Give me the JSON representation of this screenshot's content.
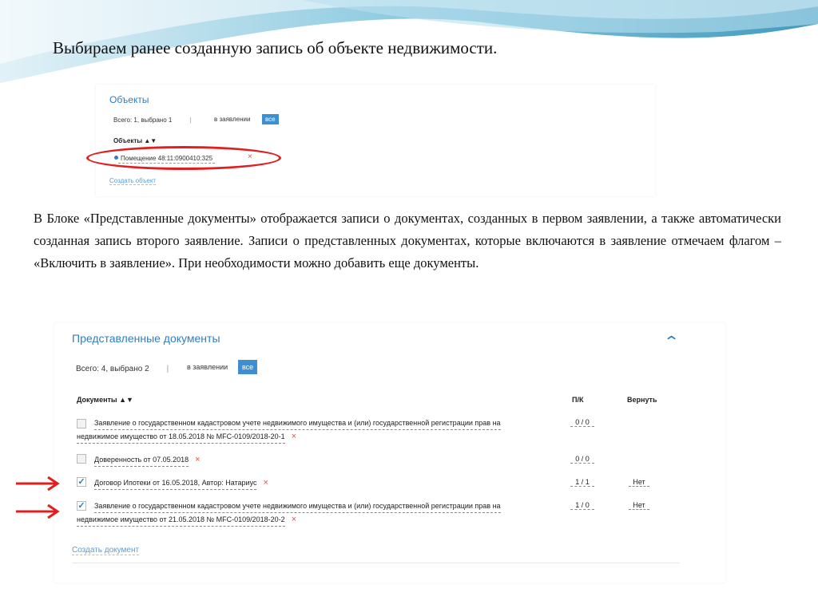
{
  "slide": {
    "title": "Выбираем ранее созданную запись об объекте недвижимости.",
    "description": "В Блоке «Представленные документы» отображается записи о документах, созданных в первом заявлении, а также автоматически созданная запись второго заявление. Записи о представленных документах, которые включаются в заявление отмечаем флагом – «Включить в заявление». При необходимости можно добавить еще документы."
  },
  "objects_panel": {
    "title": "Объекты",
    "counter": "Всего: 1, выбрано 1",
    "separator": "|",
    "in_application": "в заявлении",
    "all_button": "все",
    "column_header": "Объекты ▲▼",
    "selected_object": "Помещение 48:11:0900410:325",
    "remove_icon": "×",
    "create_link": "Создать объект"
  },
  "docs_panel": {
    "title": "Представленные документы",
    "counter": "Всего: 4, выбрано 2",
    "separator": "|",
    "in_application": "в заявлении",
    "all_button": "все",
    "collapse_icon": "chevron-up-icon",
    "col_documents": "Документы ▲▼",
    "col_pk": "П/К",
    "col_return": "Вернуть",
    "remove_icon": "×",
    "create_link": "Создать документ",
    "rows": [
      {
        "checked": false,
        "line1": "Заявление о государственном кадастровом учете недвижимого имущества и (или) государственной регистрации прав на",
        "line2": "недвижимое имущество от 18.05.2018 № MFC-0109/2018-20-1",
        "pk": "0 / 0",
        "return": ""
      },
      {
        "checked": false,
        "line1": "Доверенность от 07.05.2018",
        "line2": "",
        "pk": "0 / 0",
        "return": ""
      },
      {
        "checked": true,
        "line1": "Договор Ипотеки от 16.05.2018, Автор: Натариус",
        "line2": "",
        "pk": "1 / 1",
        "return": "Нет"
      },
      {
        "checked": true,
        "line1": "Заявление о государственном кадастровом учете недвижимого имущества и (или) государственной регистрации прав на",
        "line2": "недвижимое имущество от 21.05.2018 № MFC-0109/2018-20-2",
        "pk": "1 / 0",
        "return": "Нет"
      }
    ]
  },
  "colors": {
    "accent_blue": "#2f7ec4",
    "highlight_red": "#e02020",
    "remove_red": "#d9534f"
  }
}
